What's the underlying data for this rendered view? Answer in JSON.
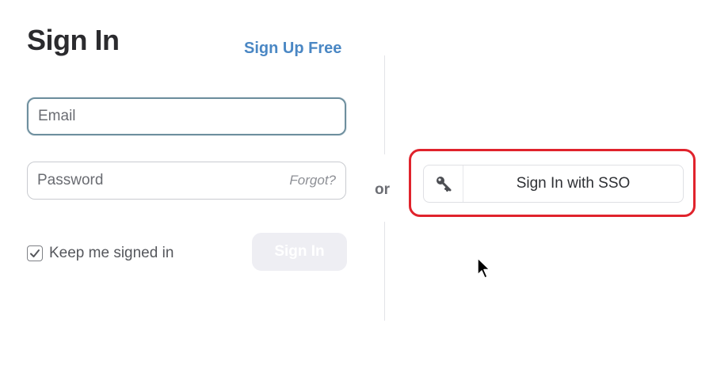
{
  "header": {
    "title": "Sign In",
    "signup_label": "Sign Up Free"
  },
  "form": {
    "email_placeholder": "Email",
    "password_placeholder": "Password",
    "forgot_label": "Forgot?",
    "keep_signed_in_label": "Keep me signed in",
    "keep_signed_in_checked": true,
    "signin_label": "Sign In"
  },
  "divider": {
    "or_label": "or"
  },
  "sso": {
    "label": "Sign In with SSO",
    "icon": "key-icon",
    "highlight_color": "#e0232c"
  },
  "colors": {
    "link": "#4a87c4",
    "signin_disabled_bg": "#eeeef3",
    "focus_border": "#6e8f9e"
  }
}
